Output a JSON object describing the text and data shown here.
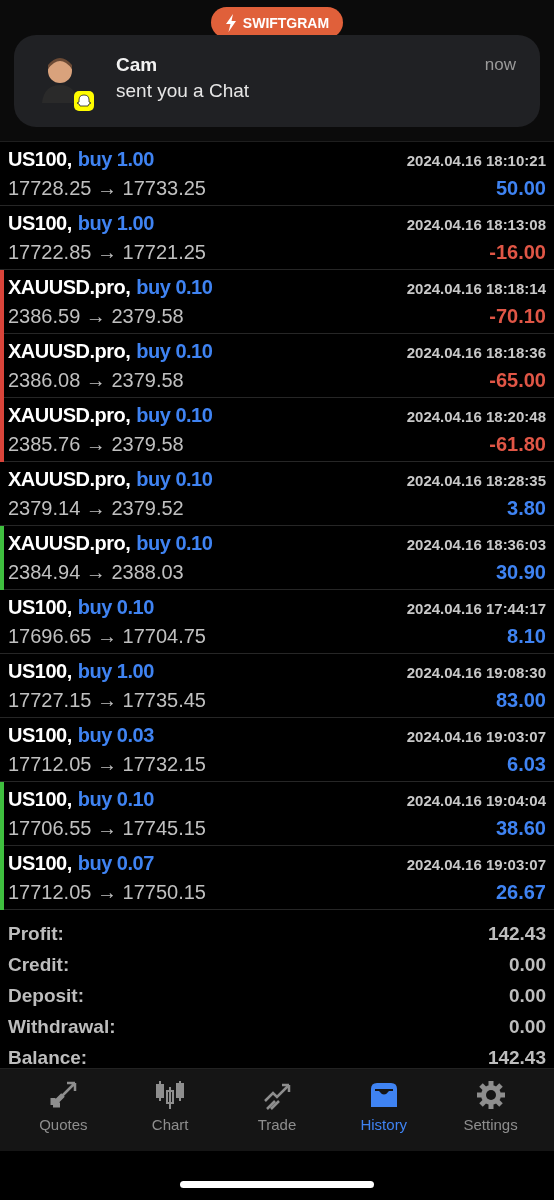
{
  "banner": {
    "label": "SWIFTGRAM"
  },
  "notification": {
    "sender": "Cam",
    "message": "sent you a Chat",
    "time": "now"
  },
  "deals": [
    {
      "symbol": "US100,",
      "action": "buy 1.00",
      "time": "2024.04.16 18:10:21",
      "prices": "17728.25 → 17733.25",
      "profit": "50.00",
      "loss": false
    },
    {
      "symbol": "US100,",
      "action": "buy 1.00",
      "time": "2024.04.16 18:13:08",
      "prices": "17722.85 → 17721.25",
      "profit": "-16.00",
      "loss": true
    },
    {
      "symbol": "XAUUSD.pro,",
      "action": "buy 0.10",
      "time": "2024.04.16 18:18:14",
      "prices": "2386.59 → 2379.58",
      "profit": "-70.10",
      "loss": true,
      "color": "#d9443a"
    },
    {
      "symbol": "XAUUSD.pro,",
      "action": "buy 0.10",
      "time": "2024.04.16 18:18:36",
      "prices": "2386.08 → 2379.58",
      "profit": "-65.00",
      "loss": true,
      "color": "#d9443a"
    },
    {
      "symbol": "XAUUSD.pro,",
      "action": "buy 0.10",
      "time": "2024.04.16 18:20:48",
      "prices": "2385.76 → 2379.58",
      "profit": "-61.80",
      "loss": true,
      "color": "#d9443a"
    },
    {
      "symbol": "XAUUSD.pro,",
      "action": "buy 0.10",
      "time": "2024.04.16 18:28:35",
      "prices": "2379.14 → 2379.52",
      "profit": "3.80",
      "loss": false
    },
    {
      "symbol": "XAUUSD.pro,",
      "action": "buy 0.10",
      "time": "2024.04.16 18:36:03",
      "prices": "2384.94 → 2388.03",
      "profit": "30.90",
      "loss": false,
      "color": "#3fbf3f"
    },
    {
      "symbol": "US100,",
      "action": "buy 0.10",
      "time": "2024.04.16 17:44:17",
      "prices": "17696.65 → 17704.75",
      "profit": "8.10",
      "loss": false
    },
    {
      "symbol": "US100,",
      "action": "buy 1.00",
      "time": "2024.04.16 19:08:30",
      "prices": "17727.15 → 17735.45",
      "profit": "83.00",
      "loss": false
    },
    {
      "symbol": "US100,",
      "action": "buy 0.03",
      "time": "2024.04.16 19:03:07",
      "prices": "17712.05 → 17732.15",
      "profit": "6.03",
      "loss": false
    },
    {
      "symbol": "US100,",
      "action": "buy 0.10",
      "time": "2024.04.16 19:04:04",
      "prices": "17706.55 → 17745.15",
      "profit": "38.60",
      "loss": false,
      "color": "#3fbf3f"
    },
    {
      "symbol": "US100,",
      "action": "buy 0.07",
      "time": "2024.04.16 19:03:07",
      "prices": "17712.05 → 17750.15",
      "profit": "26.67",
      "loss": false,
      "color": "#3fbf3f"
    }
  ],
  "summary": [
    {
      "label": "Profit:",
      "value": "142.43"
    },
    {
      "label": "Credit:",
      "value": "0.00"
    },
    {
      "label": "Deposit:",
      "value": "0.00"
    },
    {
      "label": "Withdrawal:",
      "value": "0.00"
    },
    {
      "label": "Balance:",
      "value": "142.43"
    }
  ],
  "tabs": [
    {
      "label": "Quotes",
      "kind": "quotes",
      "selected": false
    },
    {
      "label": "Chart",
      "kind": "chart",
      "selected": false
    },
    {
      "label": "Trade",
      "kind": "trade",
      "selected": false
    },
    {
      "label": "History",
      "kind": "history",
      "selected": true
    },
    {
      "label": "Settings",
      "kind": "settings",
      "selected": false
    }
  ]
}
